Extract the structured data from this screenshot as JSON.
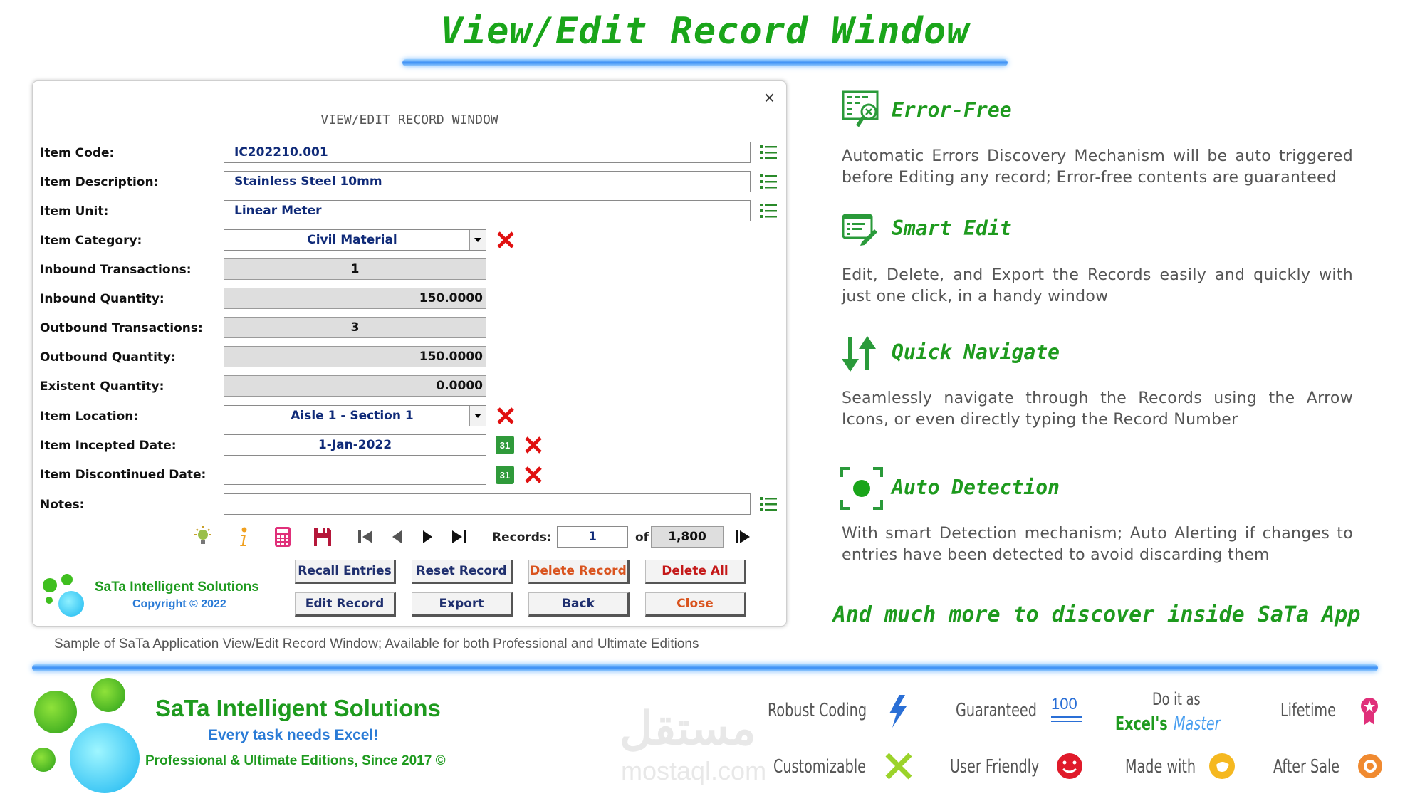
{
  "header": {
    "title": "View/Edit Record Window"
  },
  "dialog": {
    "title": "VIEW/EDIT RECORD WINDOW",
    "close_glyph": "×",
    "fields": {
      "item_code": {
        "label": "Item Code:",
        "value": "IC202210.001"
      },
      "item_description": {
        "label": "Item Description:",
        "value": "Stainless Steel 10mm"
      },
      "item_unit": {
        "label": "Item Unit:",
        "value": "Linear Meter"
      },
      "item_category": {
        "label": "Item Category:",
        "value": "Civil Material"
      },
      "inbound_transactions": {
        "label": "Inbound Transactions:",
        "value": "1"
      },
      "inbound_quantity": {
        "label": "Inbound Quantity:",
        "value": "150.0000"
      },
      "outbound_transactions": {
        "label": "Outbound Transactions:",
        "value": "3"
      },
      "outbound_quantity": {
        "label": "Outbound Quantity:",
        "value": "150.0000"
      },
      "existent_quantity": {
        "label": "Existent Quantity:",
        "value": "0.0000"
      },
      "item_location": {
        "label": "Item Location:",
        "value": "Aisle 1 - Section 1"
      },
      "incepted_date": {
        "label": "Item Incepted Date:",
        "value": "1-Jan-2022"
      },
      "discontinued_date": {
        "label": "Item Discontinued Date:",
        "value": ""
      },
      "notes": {
        "label": "Notes:",
        "value": ""
      }
    },
    "calendar_day": "31",
    "records": {
      "label": "Records:",
      "current": "1",
      "of_label": "of",
      "total": "1,800"
    },
    "buttons": {
      "recall": "Recall Entries",
      "reset": "Reset Record",
      "delete_record": "Delete Record",
      "delete_all": "Delete All",
      "edit": "Edit Record",
      "export": "Export",
      "back": "Back",
      "close": "Close"
    },
    "brand": {
      "name": "SaTa Intelligent Solutions",
      "copyright": "Copyright © 2022"
    }
  },
  "caption": "Sample of SaTa Application View/Edit Record Window; Available for both Professional and Ultimate Editions",
  "features": [
    {
      "title": "Error-Free",
      "text": "Automatic Errors Discovery Mechanism will be auto triggered before Editing any record; Error-free contents are guaranteed",
      "icon": "error-check-icon"
    },
    {
      "title": "Smart Edit",
      "text": "Edit, Delete, and Export the Records easily and quickly with just one click, in a handy window",
      "icon": "edit-form-icon"
    },
    {
      "title": "Quick Navigate",
      "text": "Seamlessly navigate through the Records using the Arrow Icons, or even directly typing the Record Number",
      "icon": "arrows-icon"
    },
    {
      "title": "Auto Detection",
      "text": "With smart Detection mechanism; Auto Alerting if changes to entries have been detected to avoid discarding them",
      "icon": "focus-icon"
    }
  ],
  "more": "And much more to discover inside SaTa App",
  "footer": {
    "brand": "SaTa Intelligent Solutions",
    "tagline": "Every task needs Excel!",
    "editions": "Professional & Ultimate Editions, Since 2017 ©",
    "badges": {
      "robust": "Robust Coding",
      "guaranteed": "Guaranteed",
      "guaranteed_num": "100",
      "doit": "Do it as",
      "excels": "Excel's",
      "master": "Master",
      "lifetime": "Lifetime",
      "customizable": "Customizable",
      "user_friendly": "User Friendly",
      "made_with": "Made with",
      "after_sale": "After Sale"
    },
    "watermark": {
      "arabic": "مستقل",
      "latin": "mostaql.com"
    }
  },
  "colors": {
    "accent_green": "#1e9a1e",
    "accent_blue": "#3a8ef5",
    "danger_red": "#e01010",
    "field_text": "#0f2a78"
  }
}
